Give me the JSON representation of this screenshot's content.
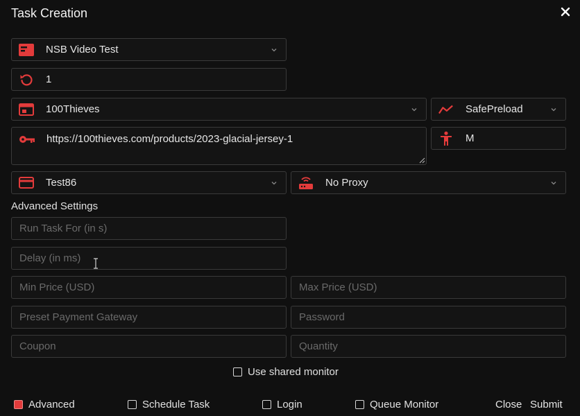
{
  "window": {
    "title": "Task Creation"
  },
  "fields": {
    "profile_group": {
      "value": "NSB Video Test",
      "icon": "profile-card-icon"
    },
    "task_count": {
      "value": "1",
      "icon": "repeat-icon"
    },
    "site": {
      "value": "100Thieves",
      "icon": "browser-window-icon"
    },
    "mode": {
      "value": "SafePreload",
      "icon": "chart-line-icon"
    },
    "product_url": {
      "value": "https://100thieves.com/products/2023-glacial-jersey-1",
      "icon": "key-icon"
    },
    "size": {
      "value": "M",
      "icon": "person-icon"
    },
    "payment_profile": {
      "value": "Test86",
      "icon": "credit-card-icon"
    },
    "proxy": {
      "value": "No Proxy",
      "icon": "router-icon"
    }
  },
  "advanced": {
    "section_label": "Advanced Settings",
    "run_task_for_placeholder": "Run Task For (in s)",
    "delay_placeholder": "Delay (in ms)",
    "min_price_placeholder": "Min Price (USD)",
    "max_price_placeholder": "Max Price (USD)",
    "preset_gateway_placeholder": "Preset Payment Gateway",
    "password_placeholder": "Password",
    "coupon_placeholder": "Coupon",
    "quantity_placeholder": "Quantity",
    "shared_monitor_label": "Use shared monitor"
  },
  "footer": {
    "advanced_label": "Advanced",
    "schedule_label": "Schedule Task",
    "login_label": "Login",
    "queue_label": "Queue Monitor",
    "close_label": "Close",
    "submit_label": "Submit"
  },
  "colors": {
    "accent": "#e33b3b",
    "background": "#101010",
    "field_border": "#3a3a3a"
  }
}
